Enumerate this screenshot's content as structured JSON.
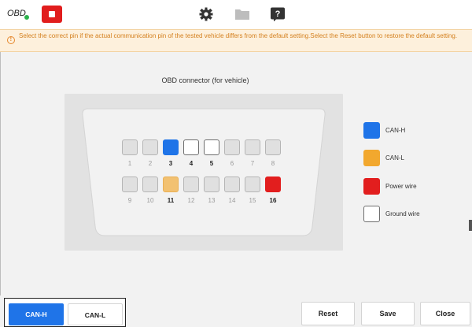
{
  "topbar": {
    "logo_text": "OBD",
    "icons": [
      "stop-icon",
      "gear-icon",
      "folder-icon",
      "help-icon"
    ]
  },
  "notice": {
    "text": "Select the correct pin if the actual communication pin of the tested vehicle differs from the default setting.Select the Reset button to restore the default setting."
  },
  "connector": {
    "title": "OBD connector (for vehicle)",
    "top_row": [
      {
        "num": "1",
        "state": "default"
      },
      {
        "num": "2",
        "state": "default"
      },
      {
        "num": "3",
        "state": "can-h"
      },
      {
        "num": "4",
        "state": "ground"
      },
      {
        "num": "5",
        "state": "ground"
      },
      {
        "num": "6",
        "state": "default"
      },
      {
        "num": "7",
        "state": "default"
      },
      {
        "num": "8",
        "state": "default"
      }
    ],
    "bottom_row": [
      {
        "num": "9",
        "state": "default"
      },
      {
        "num": "10",
        "state": "default"
      },
      {
        "num": "11",
        "state": "can-l"
      },
      {
        "num": "12",
        "state": "default"
      },
      {
        "num": "13",
        "state": "default"
      },
      {
        "num": "14",
        "state": "default"
      },
      {
        "num": "15",
        "state": "default"
      },
      {
        "num": "16",
        "state": "power"
      }
    ]
  },
  "legend": [
    {
      "label": "CAN-H",
      "color": "#1f74e8"
    },
    {
      "label": "CAN-L",
      "color": "#f2a82e"
    },
    {
      "label": "Power wire",
      "color": "#e21e1e"
    },
    {
      "label": "Ground wire",
      "color": "#ffffff"
    }
  ],
  "bottom": {
    "tabs": [
      "CAN-H",
      "CAN-L"
    ],
    "reset_label": "Reset",
    "save_label": "Save",
    "close_label": "Close"
  }
}
